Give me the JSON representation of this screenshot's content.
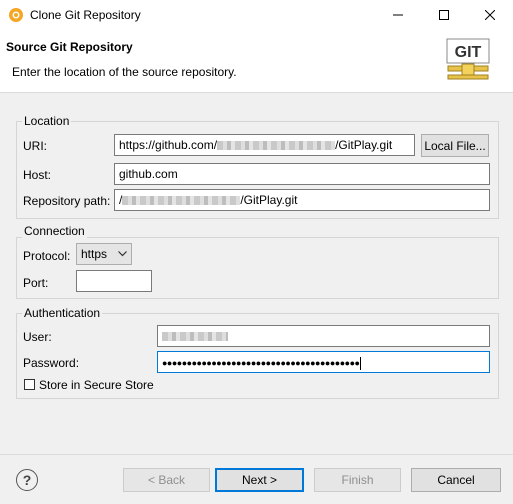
{
  "window": {
    "title": "Clone Git Repository",
    "minimize_icon": "minimize-icon",
    "maximize_icon": "maximize-icon",
    "close_icon": "close-icon"
  },
  "banner": {
    "title": "Source Git Repository",
    "description": "Enter the location of the source repository.",
    "logo_text": "GIT"
  },
  "location": {
    "group_label": "Location",
    "uri_label": "URI:",
    "uri_prefix": "https://github.com/",
    "uri_suffix": "/GitPlay.git",
    "local_file_button": "Local File...",
    "host_label": "Host:",
    "host_value": "github.com",
    "path_label": "Repository path:",
    "path_prefix": "/",
    "path_suffix": "/GitPlay.git"
  },
  "connection": {
    "group_label": "Connection",
    "protocol_label": "Protocol:",
    "protocol_value": "https",
    "port_label": "Port:",
    "port_value": ""
  },
  "authentication": {
    "group_label": "Authentication",
    "user_label": "User:",
    "password_label": "Password:",
    "password_value": "●●●●●●●●●●●●●●●●●●●●●●●●●●●●●●●●●●●●●●●●",
    "store_label": "Store in Secure Store"
  },
  "footer": {
    "help_icon": "help-icon",
    "help_symbol": "?",
    "back": "< Back",
    "next": "Next >",
    "finish": "Finish",
    "cancel": "Cancel"
  },
  "colors": {
    "accent": "#0078d7",
    "background": "#f0f0f0",
    "app_icon": "#f5a623"
  }
}
